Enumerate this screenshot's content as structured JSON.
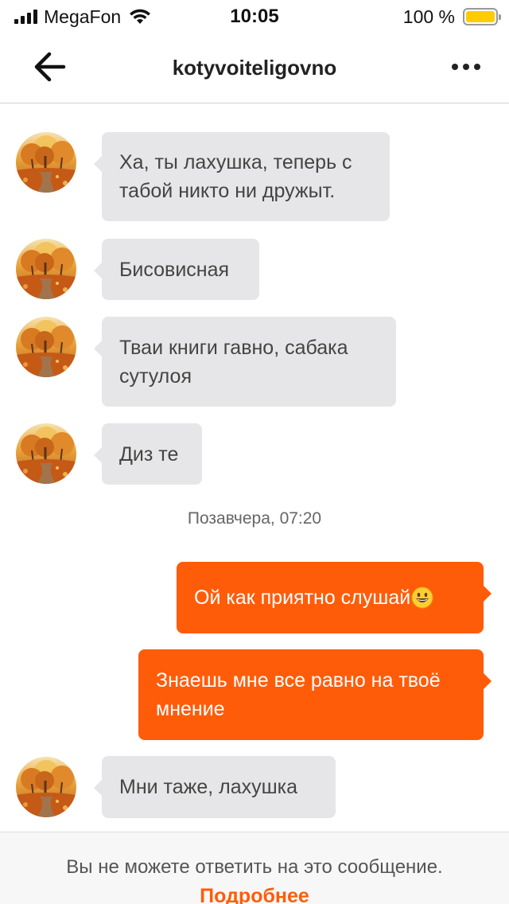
{
  "status_bar": {
    "carrier": "MegaFon",
    "time": "10:05",
    "battery_percent": "100 %",
    "battery_level": 1.0,
    "battery_color": "#ffcc00"
  },
  "nav": {
    "back_icon": "arrow-left-icon",
    "title": "kotyvoiteligovno",
    "more_icon": "more-horizontal-icon"
  },
  "messages": [
    {
      "direction": "incoming",
      "text_lines": [
        "Ха, ты лахушка, теперь с",
        "табой никто ни дружыт."
      ]
    },
    {
      "direction": "incoming",
      "text_lines": [
        "Бисовисная"
      ]
    },
    {
      "direction": "incoming",
      "text_lines": [
        "Тваи книги гавно, сабака",
        "сутулоя"
      ]
    },
    {
      "direction": "incoming",
      "text_lines": [
        "Диз те"
      ]
    },
    {
      "direction": "outgoing",
      "text_lines": [
        "Ой как приятно слушай"
      ],
      "emoji": "grinning-face"
    },
    {
      "direction": "outgoing",
      "text_lines": [
        "Знаешь мне все равно на твоё",
        "мнение"
      ]
    },
    {
      "direction": "incoming",
      "text_lines": [
        "Мни таже, лахушка"
      ]
    }
  ],
  "date_separator": "Позавчера, 07:20",
  "footer": {
    "notice": "Вы не можете ответить на это сообщение.",
    "link": "Подробнее"
  },
  "colors": {
    "accent": "#ff5c0a",
    "incoming_bubble": "#e6e6e8",
    "outgoing_text": "#ffffff"
  }
}
